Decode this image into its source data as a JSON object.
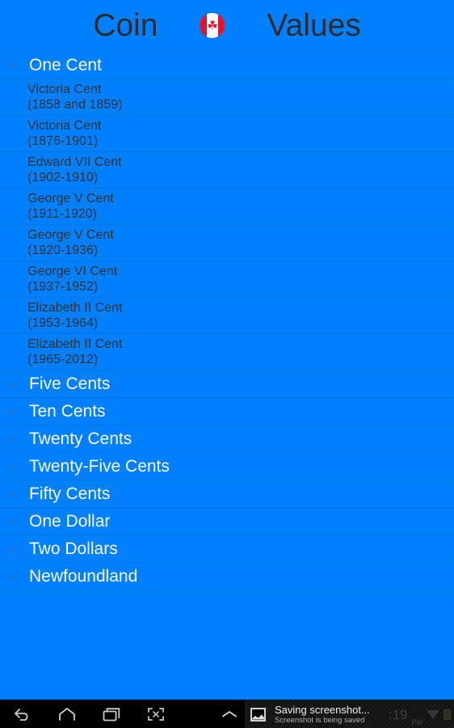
{
  "app": {
    "title_left": "Coin",
    "title_right": "Values",
    "flag_icon": "canada-flag-icon",
    "flag_leaf": "☘",
    "accent_color": "#0080FF",
    "divider_color": "#0b76e0",
    "group_text_color": "#ffffff",
    "child_text_color": "#2f2f2f",
    "title_text_color": "#2b2b2b"
  },
  "list": {
    "groups": [
      {
        "label": "One Cent",
        "expanded": true,
        "chevron": "chevron-up-icon",
        "children": [
          {
            "name": "Victoria Cent",
            "years": "(1858 and 1859)"
          },
          {
            "name": "Victoria Cent",
            "years": "(1876-1901)"
          },
          {
            "name": "Edward VII Cent",
            "years": "(1902-1910)"
          },
          {
            "name": "George V Cent",
            "years": "(1911-1920)"
          },
          {
            "name": "George V Cent",
            "years": "(1920-1936)"
          },
          {
            "name": "George VI Cent",
            "years": "(1937-1952)"
          },
          {
            "name": "Elizabeth II Cent",
            "years": "(1953-1964)"
          },
          {
            "name": "Elizabeth II Cent",
            "years": "(1965-2012)"
          }
        ]
      },
      {
        "label": "Five Cents",
        "expanded": false,
        "chevron": "chevron-down-icon",
        "children": []
      },
      {
        "label": "Ten Cents",
        "expanded": false,
        "chevron": "chevron-down-icon",
        "children": []
      },
      {
        "label": "Twenty Cents",
        "expanded": false,
        "chevron": "chevron-down-icon",
        "children": []
      },
      {
        "label": "Twenty-Five Cents",
        "expanded": false,
        "chevron": "chevron-down-icon",
        "children": []
      },
      {
        "label": "Fifty Cents",
        "expanded": false,
        "chevron": "chevron-down-icon",
        "children": []
      },
      {
        "label": "One Dollar",
        "expanded": false,
        "chevron": "chevron-down-icon",
        "children": []
      },
      {
        "label": "Two Dollars",
        "expanded": false,
        "chevron": "chevron-down-icon",
        "children": []
      },
      {
        "label": "Newfoundland",
        "expanded": false,
        "chevron": "chevron-down-icon",
        "children": []
      }
    ]
  },
  "navbar": {
    "buttons": [
      {
        "name": "back-button",
        "icon": "back-arrow-icon"
      },
      {
        "name": "home-button",
        "icon": "home-icon"
      },
      {
        "name": "recents-button",
        "icon": "recent-apps-icon"
      },
      {
        "name": "screenshot-button",
        "icon": "screenshot-icon"
      }
    ],
    "expand_icon": "chevron-up-icon",
    "notification": {
      "icon": "screenshot-image-icon",
      "title": "Saving screenshot...",
      "subtitle": "Screenshot is being saved"
    },
    "status": {
      "time": ":19",
      "ampm": "PM",
      "wifi_icon": "wifi-icon",
      "battery_icon": "battery-icon"
    }
  }
}
